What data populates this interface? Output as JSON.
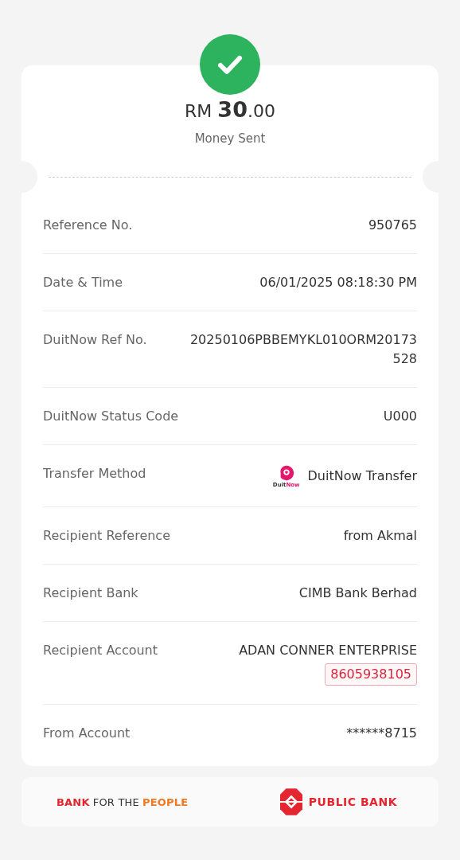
{
  "status": {
    "kind": "success"
  },
  "amount": "RM **30**.00",
  "status_label": "Money Sent",
  "details": [
    {
      "kind": "text",
      "label": "Reference No.",
      "value": "950765"
    },
    {
      "kind": "text",
      "label": "Date & Time",
      "value": "06/01/2025 08:18:30 PM"
    },
    {
      "kind": "text",
      "label": "DuitNow Ref No.",
      "value": "20250106PBBEMYKL010ORM20173528"
    },
    {
      "kind": "text",
      "label": "DuitNow Status Code",
      "value": "U000"
    },
    {
      "kind": "method",
      "label": "Transfer Method",
      "value": "DuitNow Transfer",
      "logo_text": "Duit",
      "logo_text_2": "Now"
    },
    {
      "kind": "text",
      "label": "Recipient Reference",
      "value": "from Akmal"
    },
    {
      "kind": "text",
      "label": "Recipient Bank",
      "value": "CIMB Bank Berhad"
    },
    {
      "kind": "account",
      "label": "Recipient Account",
      "value": "ADAN CONNER ENTERPRISE",
      "account_no": "8605938105"
    },
    {
      "kind": "text",
      "label": "From Account",
      "value": "******8715"
    }
  ],
  "footer": {
    "slogan": [
      {
        "text": "BANK",
        "color": "#e3262f"
      },
      {
        "text": "FOR THE",
        "color": "#333333"
      },
      {
        "text": "PEOPLE",
        "color": "#ef7a21"
      }
    ],
    "bank_name": "PUBLIC BANK"
  }
}
